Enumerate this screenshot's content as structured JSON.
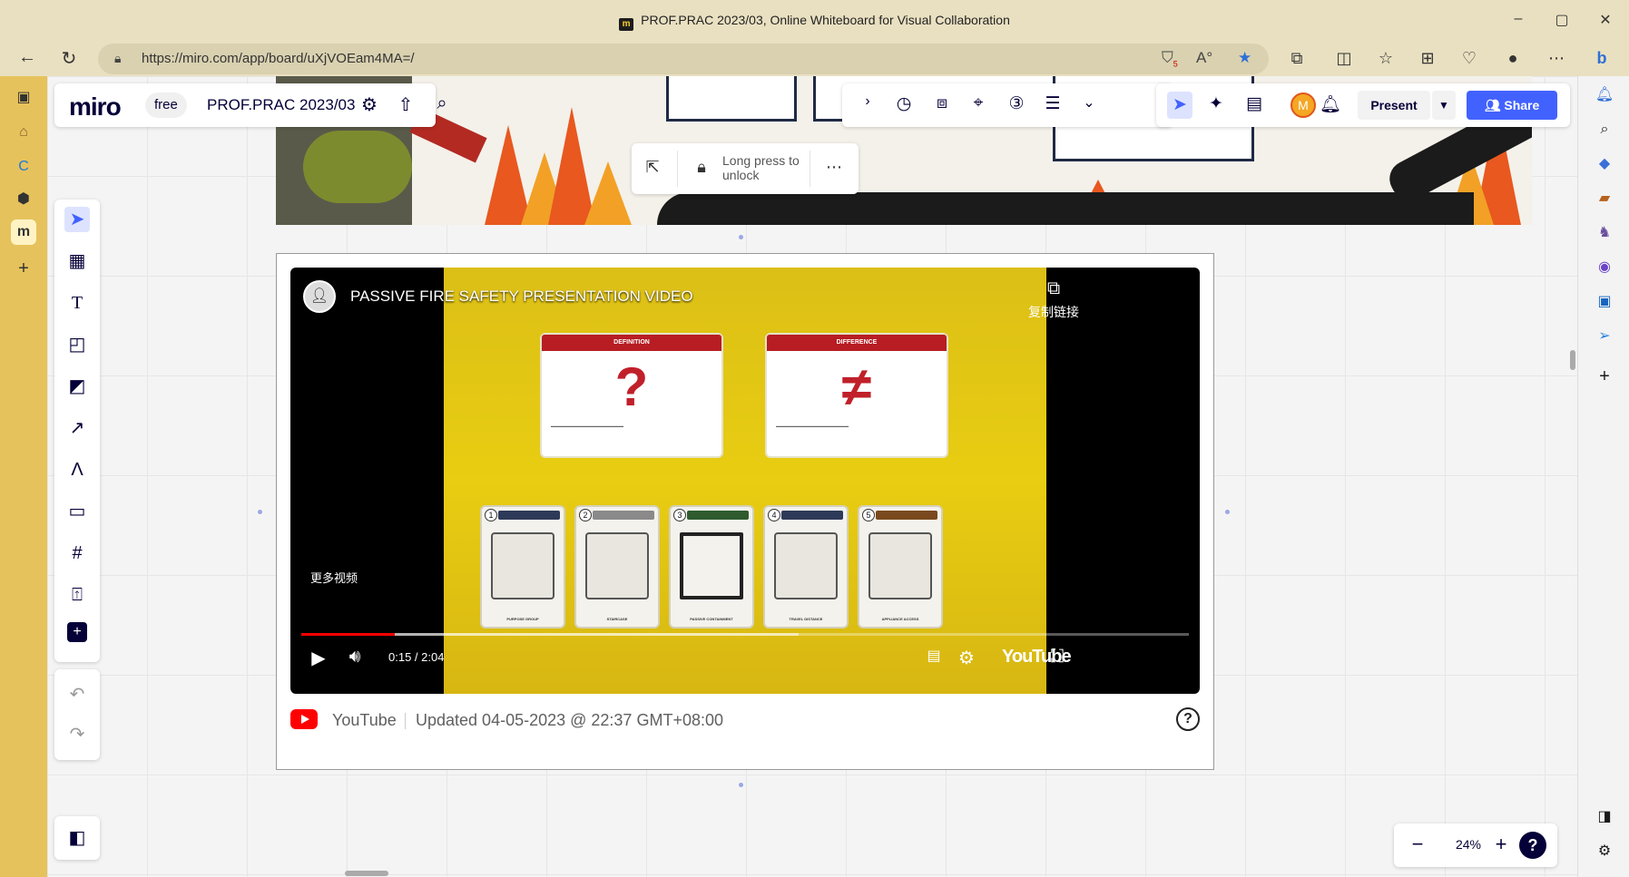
{
  "window": {
    "title": "PROF.PRAC 2023/03, Online Whiteboard for Visual Collaboration",
    "minimize": "–",
    "maximize": "▢",
    "close": "✕"
  },
  "browser": {
    "url": "https://miro.com/app/board/uXjVOEam4MA=/",
    "tracker_badge": "5"
  },
  "miro": {
    "logo": "miro",
    "plan": "free",
    "board_name": "PROF.PRAC 2023/03",
    "avatar_initial": "M",
    "present_label": "Present",
    "share_label": "Share",
    "lock_hint": "Long press to unlock",
    "zoom": "24%",
    "zoom_help": "?"
  },
  "video": {
    "title": "PASSIVE FIRE SAFETY PRESENTATION VIDEO",
    "copy_link": "复制链接",
    "more_videos": "更多视频",
    "time": "0:15 / 2:04",
    "wordmark": "YouTube",
    "progress_played": 0.105,
    "progress_buffered": 0.56,
    "slide": {
      "card_definition": "DEFINITION",
      "card_difference": "DIFFERENCE",
      "definition_symbol": "?",
      "difference_symbol": "≠",
      "steps": [
        {
          "num": "1",
          "label": "PURPOSE GROUP",
          "color": "#2e3a59"
        },
        {
          "num": "2",
          "label": "STAIRCASE",
          "color": "#8a8a8a"
        },
        {
          "num": "3",
          "label": "PASSIVE CONTAINMENT",
          "color": "#2f5b2f"
        },
        {
          "num": "4",
          "label": "TRAVEL DISTANCE",
          "color": "#2e3a59"
        },
        {
          "num": "5",
          "label": "APPLIANCE ACCESS",
          "color": "#7a4a1e"
        }
      ]
    }
  },
  "embed_footer": {
    "source": "YouTube",
    "updated": "Updated 04-05-2023 @ 22:37 GMT+08:00",
    "help": "?"
  },
  "colors": {
    "miro_blue": "#4262ff",
    "youtube_red": "#ff0000",
    "slide_yellow": "#e8cd12",
    "card_red": "#b71d23"
  }
}
